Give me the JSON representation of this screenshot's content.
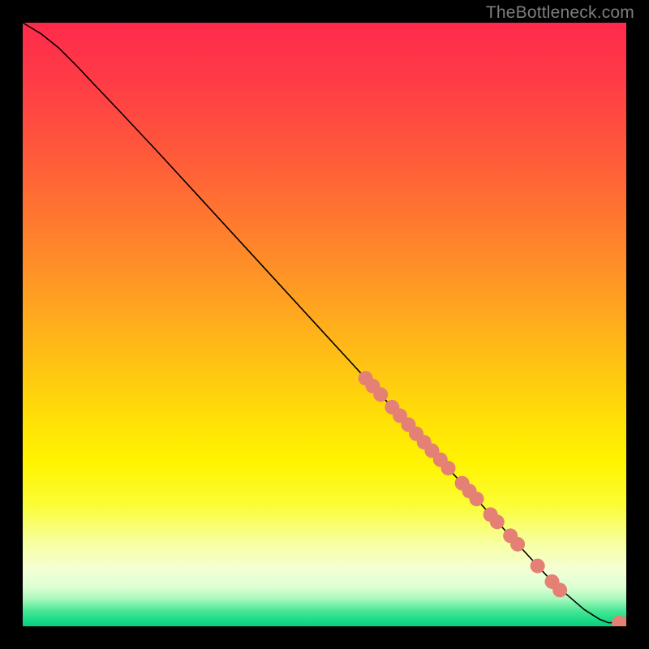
{
  "attribution": "TheBottleneck.com",
  "chart_data": {
    "type": "line",
    "title": "",
    "xlabel": "",
    "ylabel": "",
    "xlim": [
      0,
      100
    ],
    "ylim": [
      0,
      100
    ],
    "background_gradient": {
      "stops": [
        {
          "offset": 0.0,
          "color": "#ff2a4b"
        },
        {
          "offset": 0.1,
          "color": "#ff3c46"
        },
        {
          "offset": 0.22,
          "color": "#ff5a3a"
        },
        {
          "offset": 0.35,
          "color": "#ff7f2d"
        },
        {
          "offset": 0.48,
          "color": "#ffa71f"
        },
        {
          "offset": 0.58,
          "color": "#ffc712"
        },
        {
          "offset": 0.66,
          "color": "#ffe106"
        },
        {
          "offset": 0.73,
          "color": "#fff400"
        },
        {
          "offset": 0.8,
          "color": "#fbfd37"
        },
        {
          "offset": 0.86,
          "color": "#f7ff9d"
        },
        {
          "offset": 0.905,
          "color": "#f4ffd4"
        },
        {
          "offset": 0.935,
          "color": "#ddffd3"
        },
        {
          "offset": 0.955,
          "color": "#a7f8bb"
        },
        {
          "offset": 0.975,
          "color": "#45e694"
        },
        {
          "offset": 1.0,
          "color": "#00d37e"
        }
      ]
    },
    "series": [
      {
        "name": "curve",
        "color": "#000000",
        "stroke_width": 1.6,
        "points": [
          {
            "x": 0.0,
            "y": 100.0
          },
          {
            "x": 3.0,
            "y": 98.2
          },
          {
            "x": 6.0,
            "y": 95.8
          },
          {
            "x": 9.0,
            "y": 92.8
          },
          {
            "x": 12.0,
            "y": 89.6
          },
          {
            "x": 16.0,
            "y": 85.4
          },
          {
            "x": 22.0,
            "y": 79.0
          },
          {
            "x": 30.0,
            "y": 70.3
          },
          {
            "x": 40.0,
            "y": 59.4
          },
          {
            "x": 50.0,
            "y": 48.5
          },
          {
            "x": 60.0,
            "y": 37.6
          },
          {
            "x": 70.0,
            "y": 26.7
          },
          {
            "x": 80.0,
            "y": 15.8
          },
          {
            "x": 88.0,
            "y": 7.1
          },
          {
            "x": 93.0,
            "y": 2.8
          },
          {
            "x": 95.5,
            "y": 1.2
          },
          {
            "x": 97.0,
            "y": 0.6
          },
          {
            "x": 100.0,
            "y": 0.55
          }
        ]
      }
    ],
    "markers": {
      "color": "#e58074",
      "radius": 9,
      "points": [
        {
          "x": 56.8,
          "y": 41.1
        },
        {
          "x": 58.0,
          "y": 39.8
        },
        {
          "x": 59.3,
          "y": 38.4
        },
        {
          "x": 61.2,
          "y": 36.3
        },
        {
          "x": 62.5,
          "y": 34.9
        },
        {
          "x": 63.9,
          "y": 33.4
        },
        {
          "x": 65.2,
          "y": 31.9
        },
        {
          "x": 66.5,
          "y": 30.5
        },
        {
          "x": 67.8,
          "y": 29.1
        },
        {
          "x": 69.2,
          "y": 27.6
        },
        {
          "x": 70.5,
          "y": 26.2
        },
        {
          "x": 72.8,
          "y": 23.7
        },
        {
          "x": 74.0,
          "y": 22.4
        },
        {
          "x": 75.2,
          "y": 21.1
        },
        {
          "x": 77.5,
          "y": 18.5
        },
        {
          "x": 78.6,
          "y": 17.3
        },
        {
          "x": 80.8,
          "y": 15.0
        },
        {
          "x": 82.0,
          "y": 13.6
        },
        {
          "x": 85.3,
          "y": 10.0
        },
        {
          "x": 87.7,
          "y": 7.4
        },
        {
          "x": 89.0,
          "y": 6.0
        },
        {
          "x": 98.8,
          "y": 0.55
        },
        {
          "x": 100.4,
          "y": 0.55
        }
      ]
    }
  }
}
